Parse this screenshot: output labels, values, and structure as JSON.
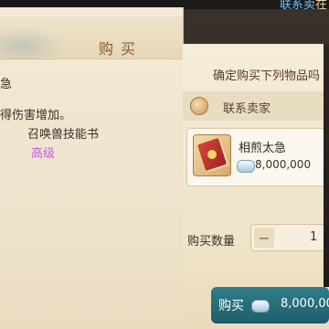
{
  "header": {
    "partial_text_left": "联系卖",
    "partial_text_right": "在",
    "title": "购买"
  },
  "item_description": {
    "name_fragment": "急",
    "effect_line_1": "得伤害增加。",
    "effect_line_2": "召唤兽技能书",
    "grade": "高级"
  },
  "purchase": {
    "confirm_prompt": "确定购买下列物品吗",
    "contact_seller_label": "联系卖家",
    "item_name": "相煎太急",
    "item_price": "8,000,000",
    "quantity_label": "购买数量",
    "quantity_minus": "−",
    "quantity_value": "1",
    "buy_label": "购买",
    "buy_total": "8,000,000"
  },
  "colors": {
    "title": "#8a5b32",
    "grade_text": "#c85adc",
    "buy_button": "#2f7e8a",
    "top_link": "#6ec0ff"
  },
  "icons": {
    "contact": "seller-coin-icon",
    "item": "skill-book-icon",
    "currency": "silver-ingot-icon"
  }
}
